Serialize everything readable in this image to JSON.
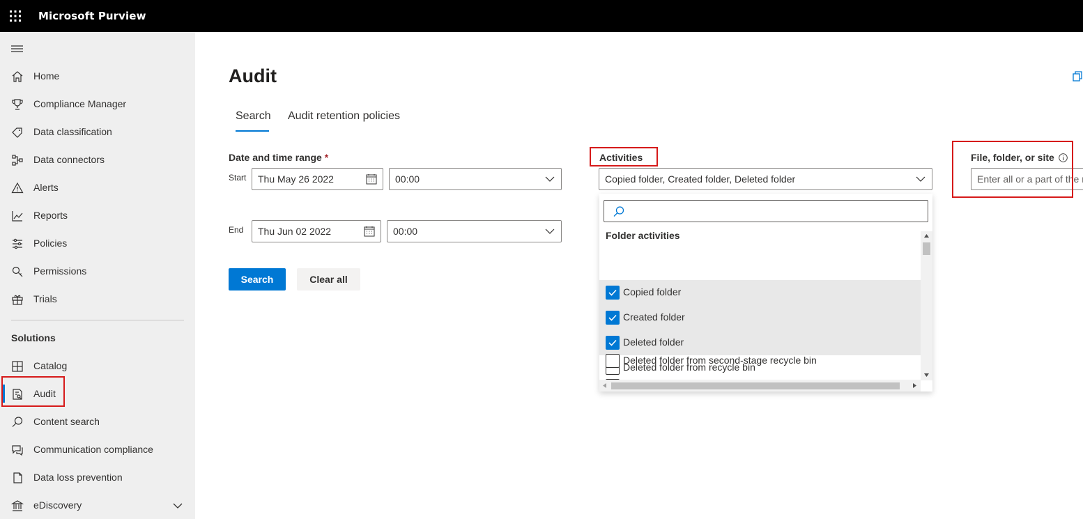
{
  "app": {
    "title": "Microsoft Purview"
  },
  "sidebar": {
    "items": [
      {
        "label": "Home",
        "icon": "home-icon"
      },
      {
        "label": "Compliance Manager",
        "icon": "trophy-icon"
      },
      {
        "label": "Data classification",
        "icon": "tag-icon"
      },
      {
        "label": "Data connectors",
        "icon": "connector-icon"
      },
      {
        "label": "Alerts",
        "icon": "warning-icon"
      },
      {
        "label": "Reports",
        "icon": "chart-icon"
      },
      {
        "label": "Policies",
        "icon": "sliders-icon"
      },
      {
        "label": "Permissions",
        "icon": "key-icon"
      },
      {
        "label": "Trials",
        "icon": "gift-icon"
      }
    ],
    "section_title": "Solutions",
    "solutions": [
      {
        "label": "Catalog",
        "icon": "grid-icon"
      },
      {
        "label": "Audit",
        "icon": "audit-doc-icon"
      },
      {
        "label": "Content search",
        "icon": "search-icon"
      },
      {
        "label": "Communication compliance",
        "icon": "chat-icon"
      },
      {
        "label": "Data loss prevention",
        "icon": "shield-doc-icon"
      },
      {
        "label": "eDiscovery",
        "icon": "courthouse-icon"
      }
    ]
  },
  "page": {
    "title": "Audit",
    "tabs": [
      {
        "label": "Search"
      },
      {
        "label": "Audit retention policies"
      }
    ]
  },
  "form": {
    "date_range_label": "Date and time range",
    "required_mark": "*",
    "start_label": "Start",
    "end_label": "End",
    "start_date": "Thu May 26 2022",
    "start_time": "00:00",
    "end_date": "Thu Jun 02 2022",
    "end_time": "00:00",
    "search_button": "Search",
    "clear_button": "Clear all",
    "activities_label": "Activities",
    "activities_value": "Copied folder, Created folder, Deleted folder",
    "file_label": "File, folder, or site",
    "file_placeholder": "Enter all or a part of the n"
  },
  "dropdown": {
    "group": "Folder activities",
    "options": [
      {
        "label": "Copied folder",
        "checked": true
      },
      {
        "label": "Created folder",
        "checked": true
      },
      {
        "label": "Deleted folder",
        "checked": true
      },
      {
        "label": "Deleted folder from recycle bin",
        "checked": false
      },
      {
        "label": "Deleted folder from second-stage recycle bin",
        "checked": false
      }
    ]
  },
  "colors": {
    "accent": "#0078d4",
    "highlight_box": "#d61a1a"
  }
}
